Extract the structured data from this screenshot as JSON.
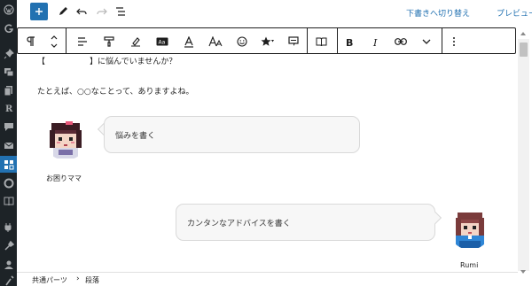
{
  "topbar": {
    "draft_switch_label": "下書きへ切り替え",
    "preview_label": "プレビュー"
  },
  "content": {
    "line1_open": "【",
    "line1_close": "】に悩んでいませんか？",
    "line2": "たとえば、○○なことって、ありますよね。"
  },
  "balloon_left": {
    "text": "悩みを書く",
    "speaker": "お困りママ"
  },
  "balloon_right": {
    "text": "カンタンなアドバイスを書く",
    "speaker": "Rumi"
  },
  "breadcrumb": {
    "items": [
      "共通パーツ",
      "段落"
    ],
    "separator": "›"
  },
  "colors": {
    "admin_sidebar": "#1d2327",
    "accent_blue": "#2271b1",
    "balloon_bg": "#f7f7f7",
    "balloon_border": "#d9d9d9"
  }
}
